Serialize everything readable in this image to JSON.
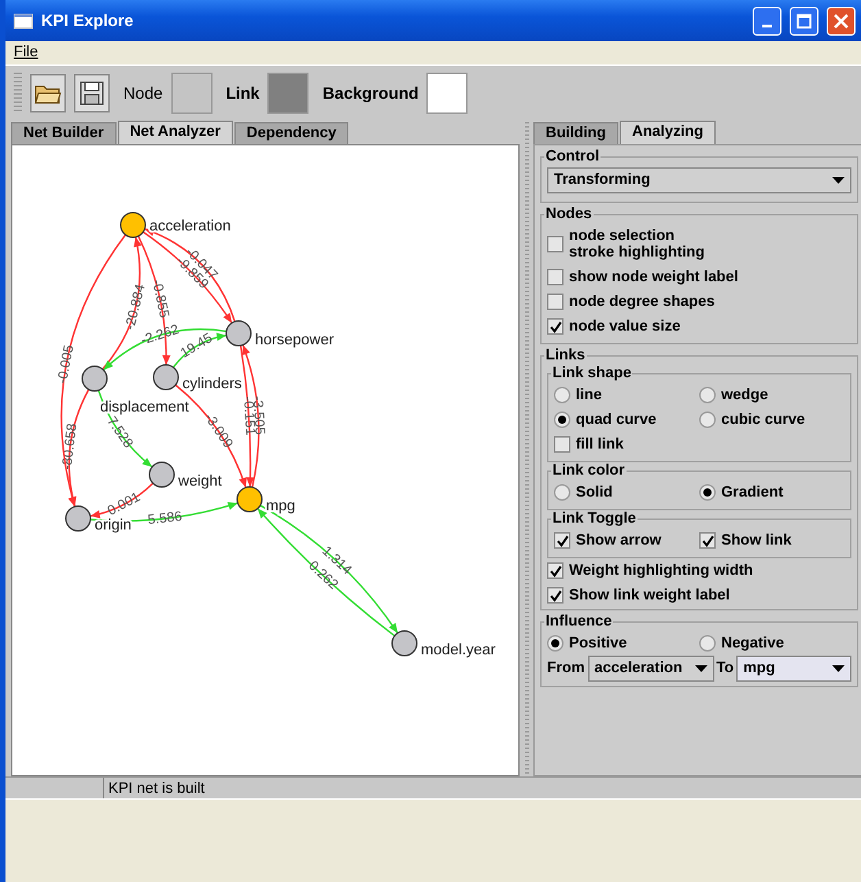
{
  "window": {
    "title": "KPI Explore"
  },
  "menu": [
    "File"
  ],
  "toolbar": {
    "swatches": [
      {
        "label": "Node",
        "bold": false,
        "color": "#c4c4c4"
      },
      {
        "label": "Link",
        "bold": true,
        "color": "#808080"
      },
      {
        "label": "Background",
        "bold": true,
        "color": "#ffffff"
      }
    ]
  },
  "left_tabs": [
    {
      "label": "Net Builder",
      "selected": false
    },
    {
      "label": "Net Analyzer",
      "selected": true
    },
    {
      "label": "Dependency",
      "selected": false
    }
  ],
  "graph": {
    "nodes": [
      {
        "label": "acceleration",
        "highlighted": true
      },
      {
        "label": "horsepower",
        "highlighted": false
      },
      {
        "label": "displacement",
        "highlighted": false
      },
      {
        "label": "cylinders",
        "highlighted": false
      },
      {
        "label": "weight",
        "highlighted": false
      },
      {
        "label": "mpg",
        "highlighted": true
      },
      {
        "label": "origin",
        "highlighted": false
      },
      {
        "label": "model.year",
        "highlighted": false
      }
    ],
    "links": [
      {
        "label": "-20.884",
        "color": "#ff3333"
      },
      {
        "label": "-0.855",
        "color": "#ff3333"
      },
      {
        "label": "-0.047",
        "color": "#ff3333"
      },
      {
        "label": "-9.859",
        "color": "#ff3333"
      },
      {
        "label": "-2.262",
        "color": "#33dd33"
      },
      {
        "label": "19.45",
        "color": "#33dd33"
      },
      {
        "label": "-3.505",
        "color": "#ff3333"
      },
      {
        "label": "-0.151",
        "color": "#ff3333"
      },
      {
        "label": "-80.658",
        "color": "#ff3333"
      },
      {
        "label": "-0.005",
        "color": "#ff3333"
      },
      {
        "label": "0.001",
        "color": "#ff3333"
      },
      {
        "label": "7.528",
        "color": "#33dd33"
      },
      {
        "label": "-3.009",
        "color": "#ff3333"
      },
      {
        "label": "5.586",
        "color": "#33dd33"
      },
      {
        "label": "1.314",
        "color": "#33dd33"
      },
      {
        "label": "0.262",
        "color": "#33dd33"
      }
    ]
  },
  "right_tabs": [
    {
      "label": "Building",
      "selected": false
    },
    {
      "label": "Analyzing",
      "selected": true
    }
  ],
  "control": {
    "title": "Control",
    "value": "Transforming"
  },
  "nodes_group": {
    "title": "Nodes",
    "options": [
      {
        "label": "node selection\nstroke highlighting",
        "checked": false
      },
      {
        "label": "show node weight label",
        "checked": false
      },
      {
        "label": "node degree shapes",
        "checked": false
      },
      {
        "label": "node value size",
        "checked": true
      }
    ]
  },
  "links_group": {
    "title": "Links",
    "link_shape": {
      "title": "Link shape",
      "options": [
        {
          "label": "line",
          "selected": false
        },
        {
          "label": "wedge",
          "selected": false
        },
        {
          "label": "quad curve",
          "selected": true
        },
        {
          "label": "cubic curve",
          "selected": false
        }
      ],
      "fill_link": {
        "label": "fill link",
        "checked": false
      }
    },
    "link_color": {
      "title": "Link color",
      "options": [
        {
          "label": "Solid",
          "selected": false
        },
        {
          "label": "Gradient",
          "selected": true
        }
      ]
    },
    "link_toggle": {
      "title": "Link Toggle",
      "options": [
        {
          "label": "Show arrow",
          "checked": true
        },
        {
          "label": "Show link",
          "checked": true
        }
      ]
    },
    "options": [
      {
        "label": "Weight highlighting width",
        "checked": true
      },
      {
        "label": "Show link weight label",
        "checked": true
      }
    ]
  },
  "influence": {
    "title": "Influence",
    "options": [
      {
        "label": "Positive",
        "selected": true
      },
      {
        "label": "Negative",
        "selected": false
      }
    ],
    "from_label": "From",
    "from_value": "acceleration",
    "to_label": "To",
    "to_value": "mpg"
  },
  "status_bar": {
    "message": "KPI net is built"
  }
}
